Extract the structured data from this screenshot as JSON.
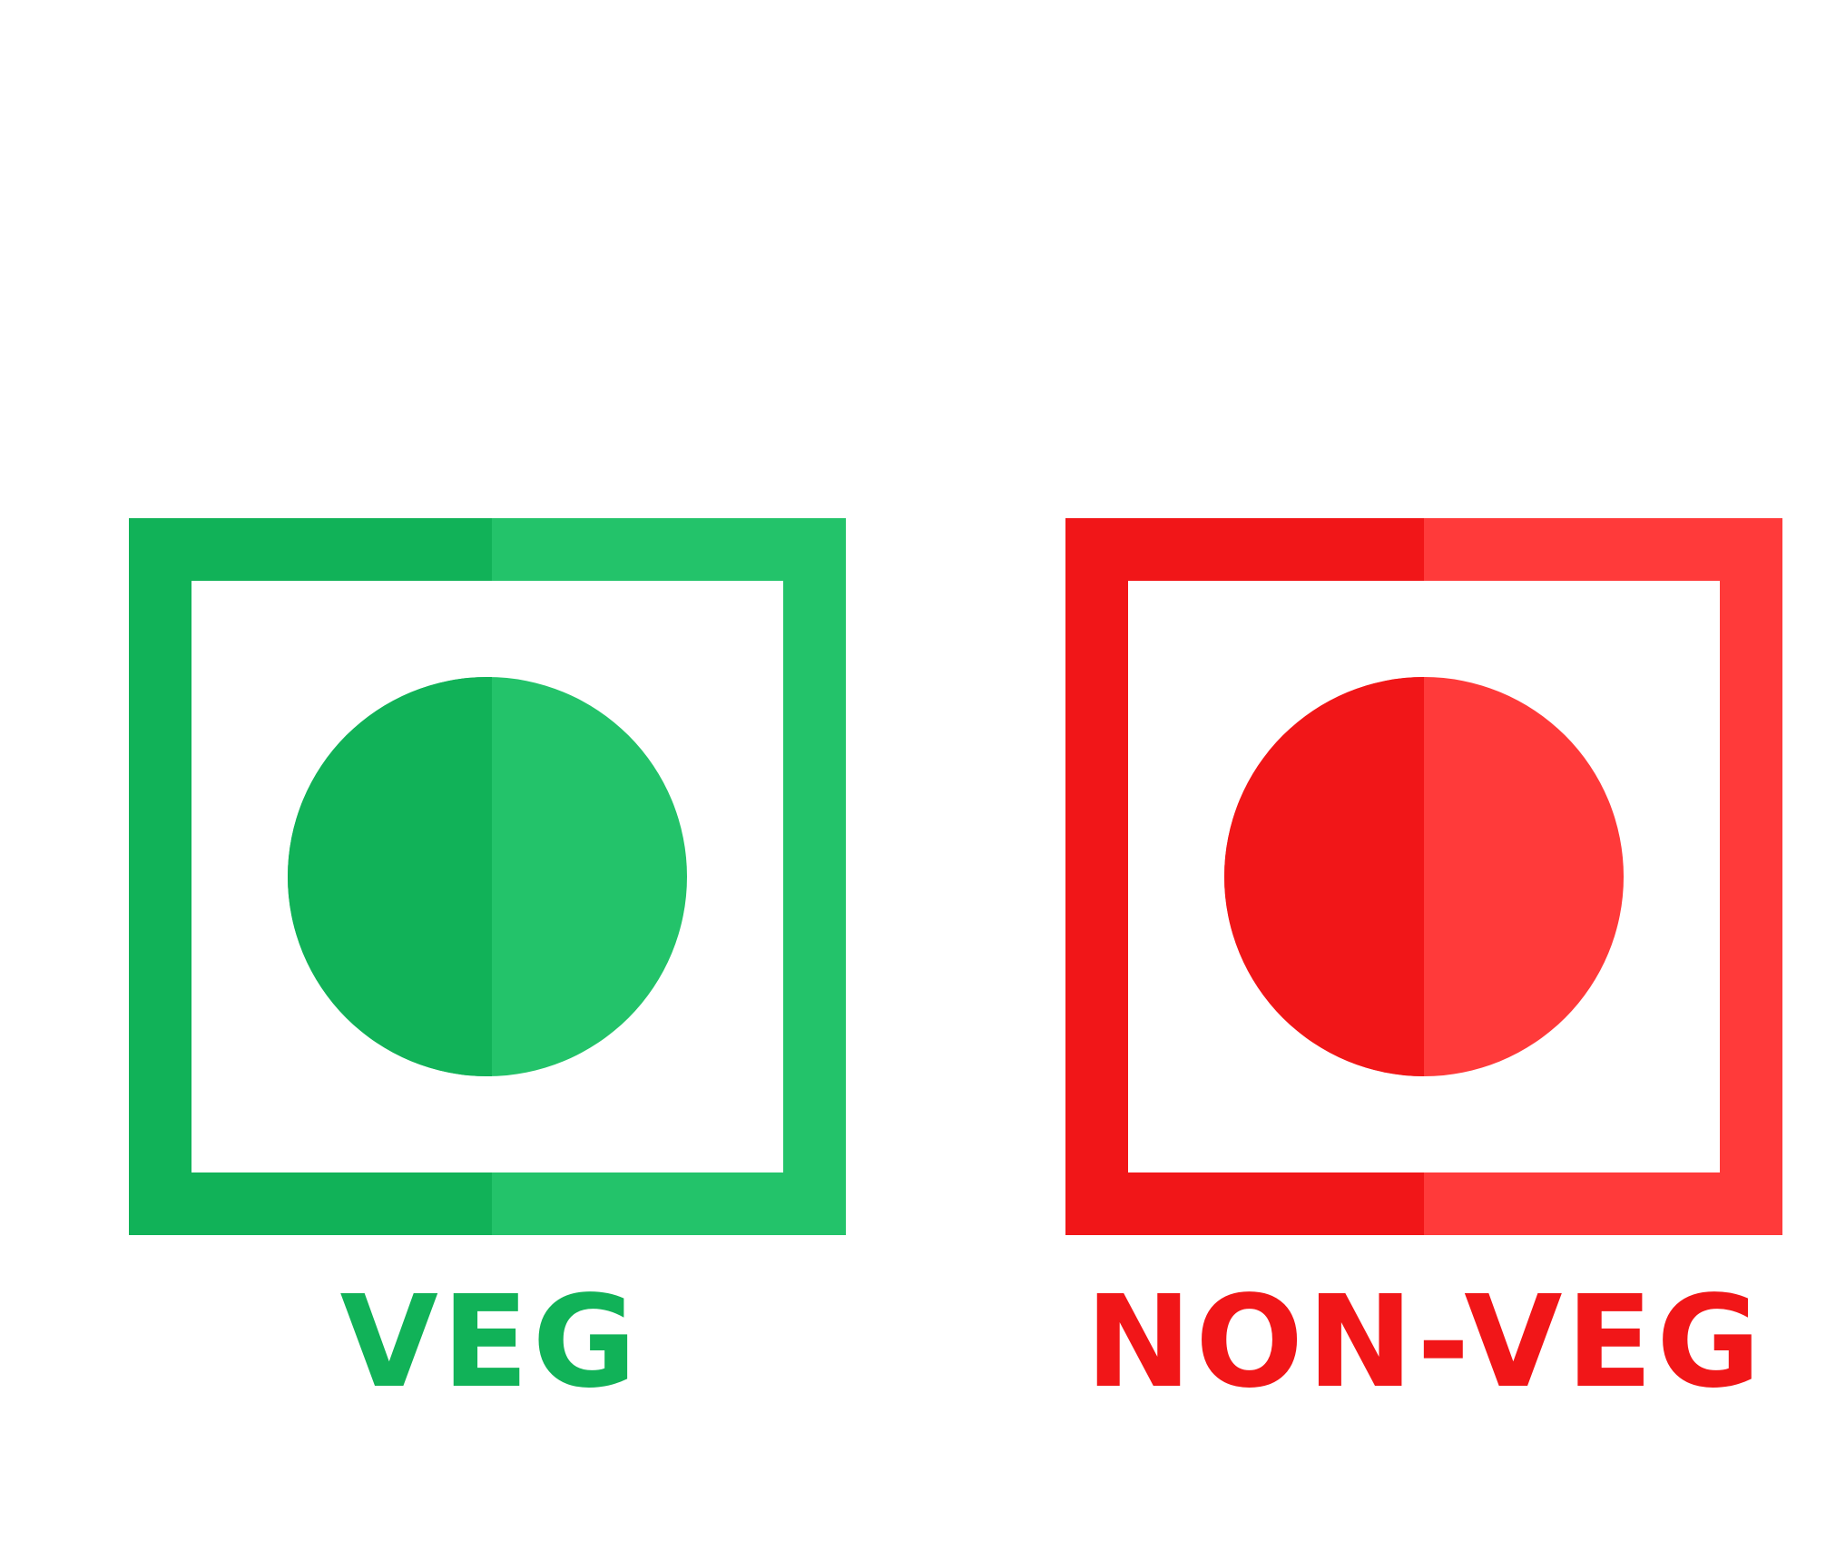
{
  "veg": {
    "label": "VEG",
    "color_dark": "#11B258",
    "color_light": "#23C36A"
  },
  "non_veg": {
    "label": "NON-VEG",
    "color_dark": "#F11618",
    "color_light": "#FF3A3A"
  },
  "background": "#FFFFFF"
}
